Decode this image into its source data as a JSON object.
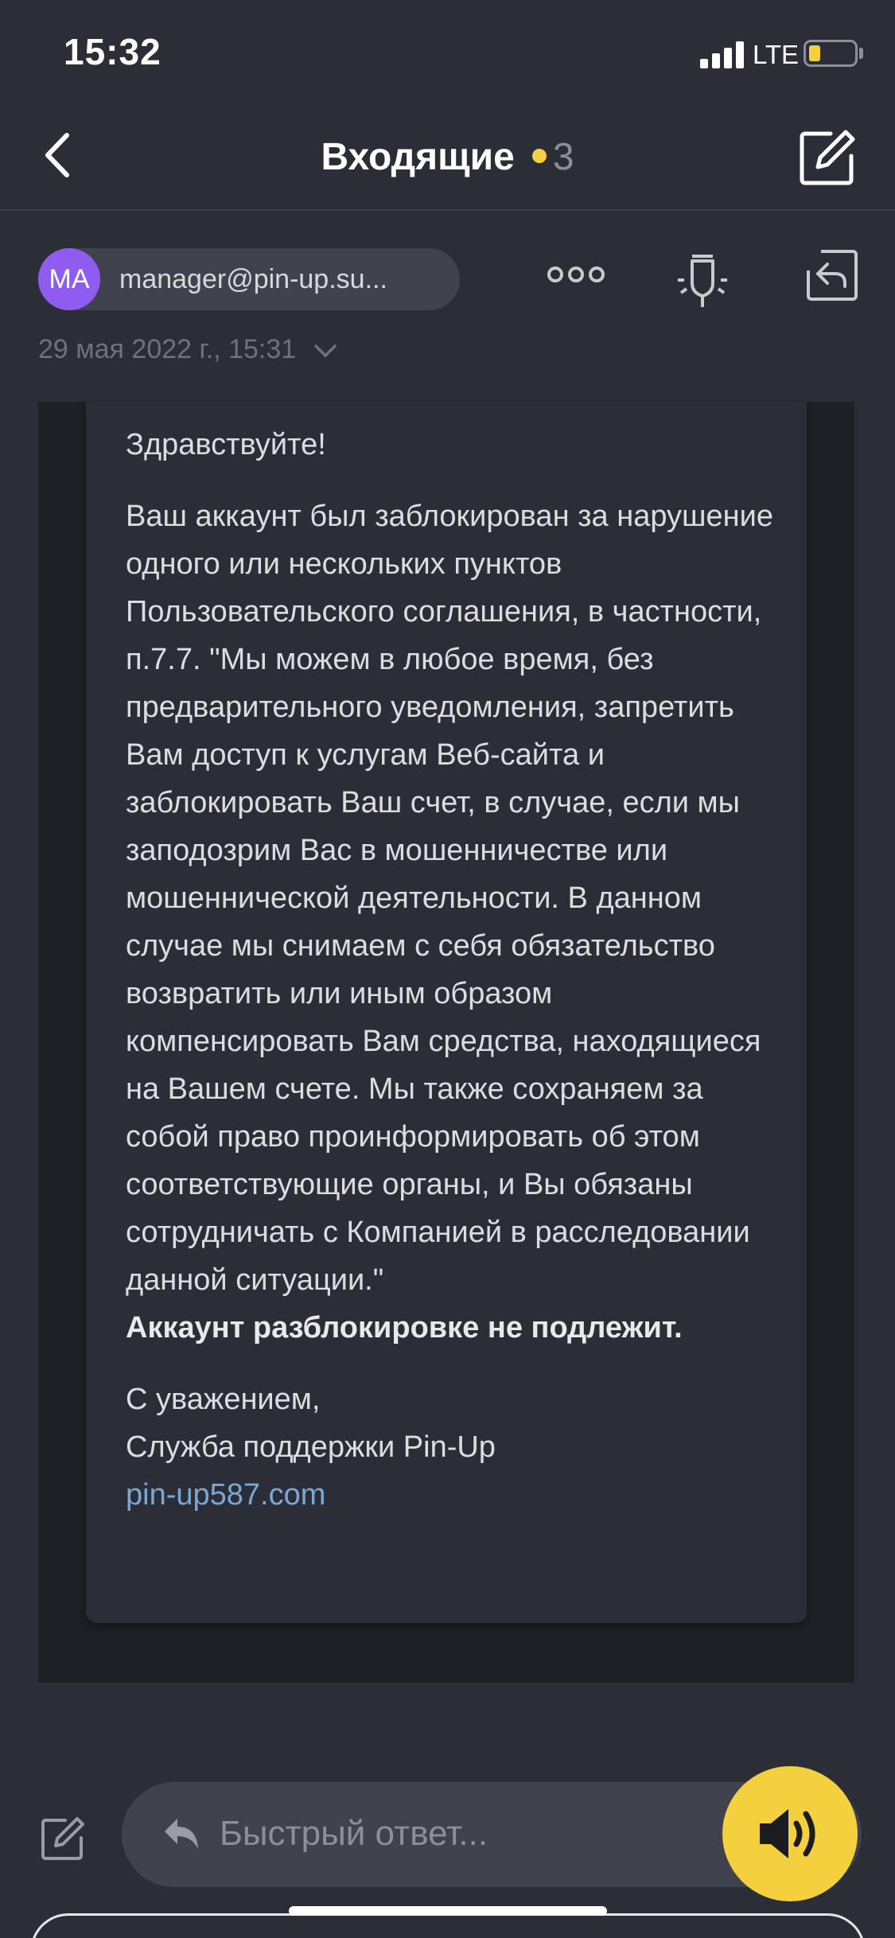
{
  "status_bar": {
    "time": "15:32",
    "network": "LTE",
    "battery_level": 0.15,
    "battery_color": "#f4d03f"
  },
  "nav": {
    "back_icon": "chevron-left-icon",
    "title": "Входящие",
    "unread_count": "3",
    "unread_dot_color": "#f4d03f",
    "compose_icon": "compose-icon"
  },
  "message": {
    "avatar_initials": "MA",
    "avatar_color": "#8e5cf0",
    "sender": "manager@pin-up.su...",
    "date": "29 мая 2022 г., 15:31",
    "actions": [
      "more-icon",
      "bulb-icon",
      "reply-icon"
    ],
    "greeting": "Здравствуйте!",
    "paragraph": "Ваш аккаунт был заблокирован за нарушение одного или нескольких пунктов Пользовательского соглашения, в частности, п.7.7. \"Мы можем в любое время, без предварительного уведомления, запретить Вам доступ к услугам Веб-сайта и заблокировать Ваш счет, в случае, если мы заподозрим Вас в мошенничестве или мошеннической деятельности. В данном случае мы снимаем с себя обязательство возвратить или иным образом компенсировать Вам средства, находящиеся на Вашем счете. Мы также сохраняем за собой право проинформировать об этом соответствующие органы, и Вы обязаны сотрудничать с Компанией в расследовании данной ситуации.\"",
    "bold_line": "Аккаунт разблокировке не подлежит.",
    "closing": "С уважением,",
    "signature": "Служба поддержки Pin-Up",
    "link": "pin-up587.com",
    "link_color": "#7ba7d4"
  },
  "bottom_bar": {
    "compose_icon": "compose-icon",
    "quick_reply_placeholder": "Быстрый ответ...",
    "voice_icon": "speaker-icon",
    "voice_button_color": "#f4d03f"
  }
}
